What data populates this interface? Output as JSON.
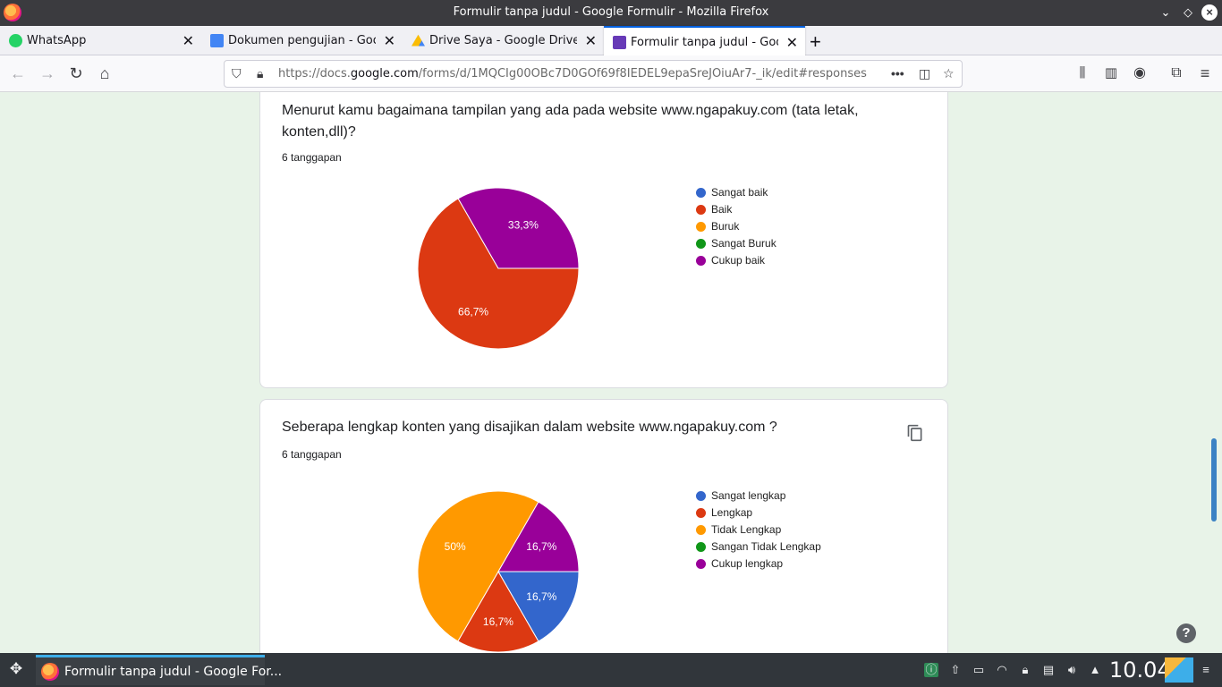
{
  "window": {
    "title": "Formulir tanpa judul - Google Formulir - Mozilla Firefox"
  },
  "tabs": [
    {
      "label": "WhatsApp",
      "icon": "whatsapp-icon",
      "color": "#25d366",
      "active": false
    },
    {
      "label": "Dokumen pengujian - Goo",
      "icon": "docs-icon",
      "color": "#4285f4",
      "active": false
    },
    {
      "label": "Drive Saya - Google Drive",
      "icon": "drive-icon",
      "color": "#fbbc04",
      "active": false
    },
    {
      "label": "Formulir tanpa judul - Goo",
      "icon": "forms-icon",
      "color": "#673ab7",
      "active": true
    }
  ],
  "urlbar": {
    "url_prefix": "https://docs.",
    "url_domain": "google.com",
    "url_suffix": "/forms/d/1MQCIg00OBc7D0GOf69f8IEDEL9epaSreJOiuAr7-_ik/edit#responses"
  },
  "questions": [
    {
      "title": "Menurut kamu bagaimana tampilan yang ada pada website www.ngapakuy.com (tata letak, konten,dll)?",
      "count": "6 tanggapan",
      "legend": [
        {
          "label": "Sangat baik",
          "color": "#3366cc"
        },
        {
          "label": "Baik",
          "color": "#dc3912"
        },
        {
          "label": "Buruk",
          "color": "#ff9900"
        },
        {
          "label": "Sangat Buruk",
          "color": "#109618"
        },
        {
          "label": "Cukup baik",
          "color": "#990099"
        }
      ]
    },
    {
      "title": "Seberapa lengkap konten yang disajikan dalam website www.ngapakuy.com ?",
      "count": "6 tanggapan",
      "legend": [
        {
          "label": "Sangat lengkap",
          "color": "#3366cc"
        },
        {
          "label": "Lengkap",
          "color": "#dc3912"
        },
        {
          "label": "Tidak Lengkap",
          "color": "#ff9900"
        },
        {
          "label": "Sangan Tidak Lengkap",
          "color": "#109618"
        },
        {
          "label": "Cukup lengkap",
          "color": "#990099"
        }
      ]
    }
  ],
  "chart_data": [
    {
      "type": "pie",
      "categories": [
        "Sangat baik",
        "Baik",
        "Buruk",
        "Sangat Buruk",
        "Cukup baik"
      ],
      "values": [
        0,
        66.7,
        0,
        0,
        33.3
      ],
      "labels": [
        "",
        "66,7%",
        "",
        "",
        "33,3%"
      ],
      "colors": [
        "#3366cc",
        "#dc3912",
        "#ff9900",
        "#109618",
        "#990099"
      ]
    },
    {
      "type": "pie",
      "categories": [
        "Sangat lengkap",
        "Lengkap",
        "Tidak Lengkap",
        "Sangan Tidak Lengkap",
        "Cukup lengkap"
      ],
      "values": [
        16.7,
        16.7,
        50,
        0,
        16.7
      ],
      "labels": [
        "16,7%",
        "16,7%",
        "50%",
        "",
        "16,7%"
      ],
      "colors": [
        "#3366cc",
        "#dc3912",
        "#ff9900",
        "#109618",
        "#990099"
      ]
    }
  ],
  "taskbar": {
    "task_label": "Formulir tanpa judul - Google For...",
    "clock": "10.04"
  },
  "help_label": "?"
}
